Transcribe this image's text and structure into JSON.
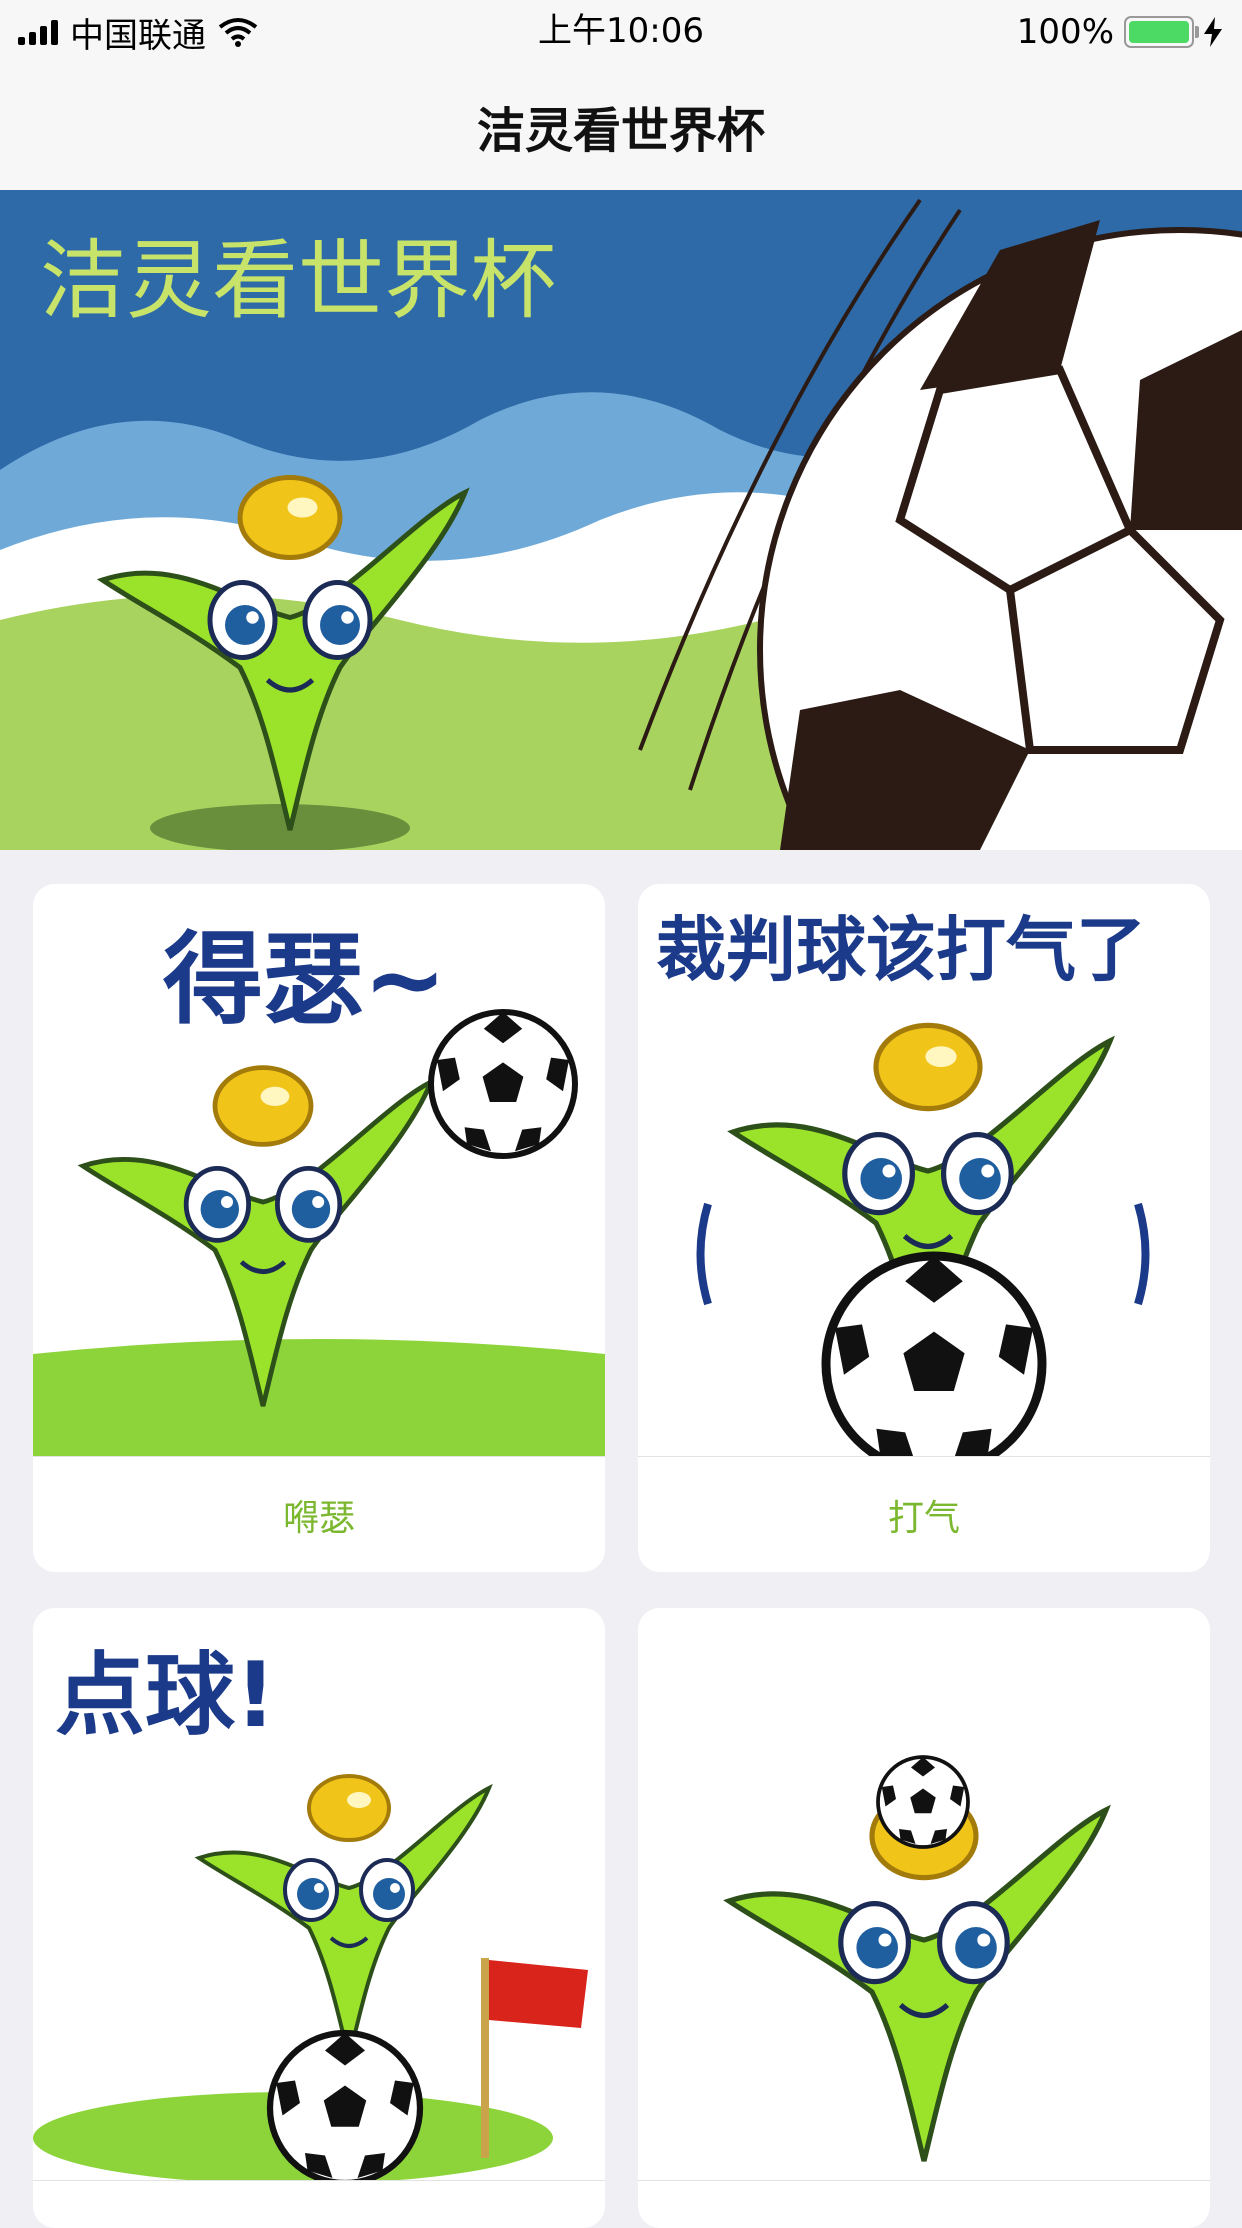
{
  "status": {
    "carrier": "中国联通",
    "time": "上午10:06",
    "battery": "100%"
  },
  "nav": {
    "title": "洁灵看世界杯"
  },
  "banner": {
    "headline": "洁灵看世界杯"
  },
  "cards": [
    {
      "image_text": "得瑟~",
      "caption": "嘚瑟"
    },
    {
      "image_text": "裁判球该打气了",
      "caption": "打气"
    },
    {
      "image_text": "点球!",
      "caption": ""
    },
    {
      "image_text": "",
      "caption": ""
    }
  ],
  "colors": {
    "accent": "#7cb82f",
    "sky": "#2e6aa8",
    "grass": "#8cd43a",
    "character": "#9be22a"
  }
}
